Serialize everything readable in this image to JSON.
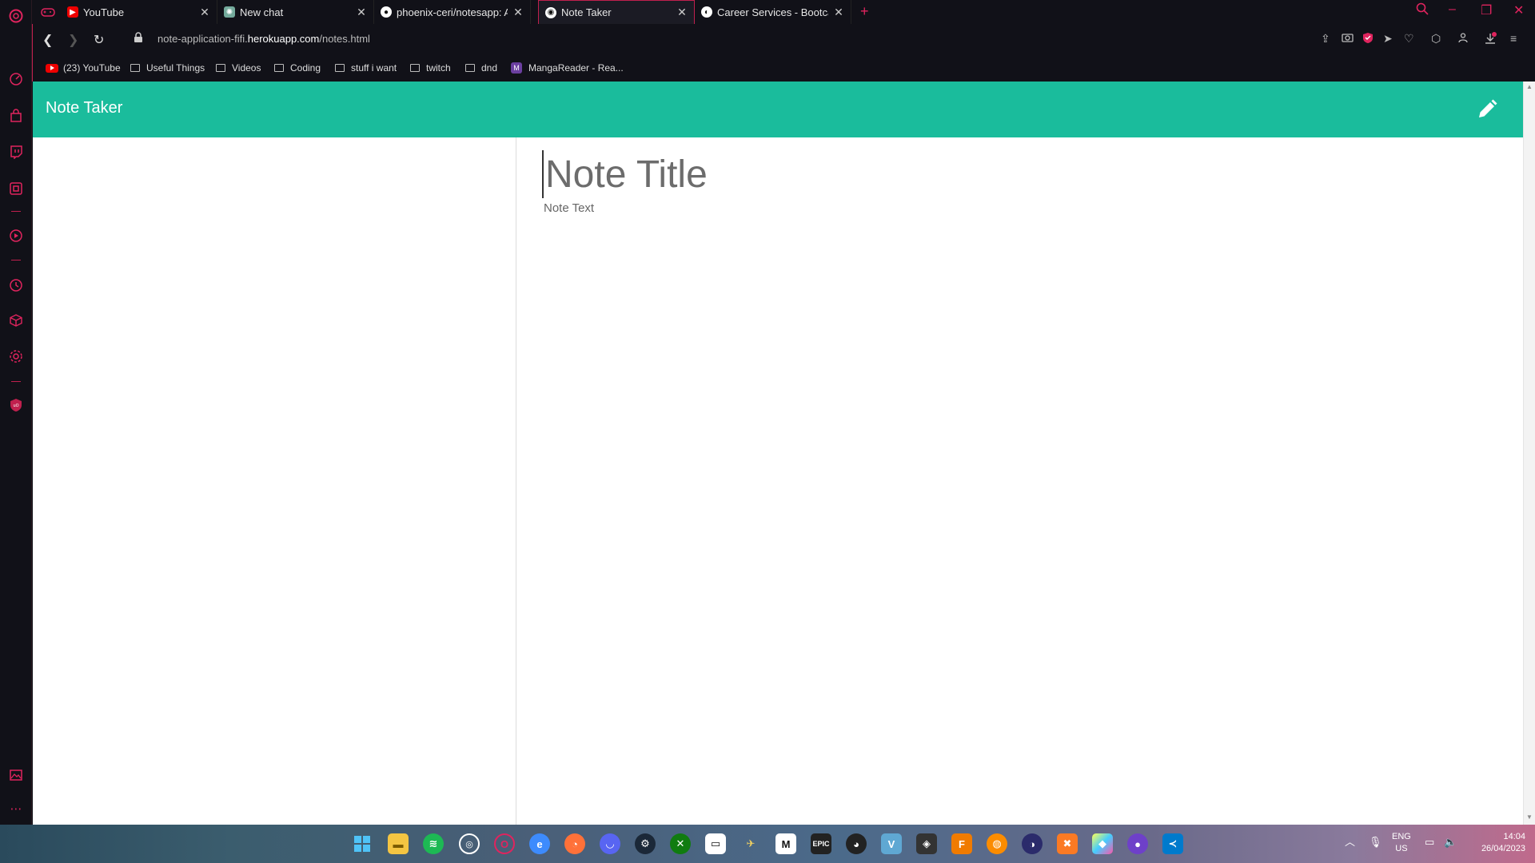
{
  "browser": {
    "tabs": [
      {
        "title": "YouTube",
        "favicon": "youtube-icon",
        "color": "#e00000"
      },
      {
        "title": "New chat",
        "favicon": "chatgpt-icon",
        "color": "#74aa9c"
      },
      {
        "title": "phoenix-ceri/notesapp: A n",
        "favicon": "github-icon",
        "color": "#ffffff"
      },
      {
        "title": "Note Taker",
        "favicon": "globe-icon",
        "color": "#ffffff",
        "active": true
      },
      {
        "title": "Career Services - Bootcamp",
        "favicon": "edx-icon",
        "color": "#ffffff"
      }
    ],
    "url_prefix": "note-application-fifi.",
    "url_domain": "herokuapp.com",
    "url_path": "/notes.html",
    "bookmarks": [
      {
        "label": "(23) YouTube",
        "type": "youtube"
      },
      {
        "label": "Useful Things",
        "type": "folder"
      },
      {
        "label": "Videos",
        "type": "folder"
      },
      {
        "label": "Coding",
        "type": "folder"
      },
      {
        "label": "stuff i want",
        "type": "folder"
      },
      {
        "label": "twitch",
        "type": "folder"
      },
      {
        "label": "dnd",
        "type": "folder"
      },
      {
        "label": "MangaReader - Rea...",
        "type": "site"
      }
    ]
  },
  "app": {
    "brand": "Note Taker",
    "title_placeholder": "Note Title",
    "text_placeholder": "Note Text",
    "accent_color": "#1abc9c"
  },
  "taskbar": {
    "language": "ENG",
    "region": "US",
    "time": "14:04",
    "date": "26/04/2023"
  }
}
